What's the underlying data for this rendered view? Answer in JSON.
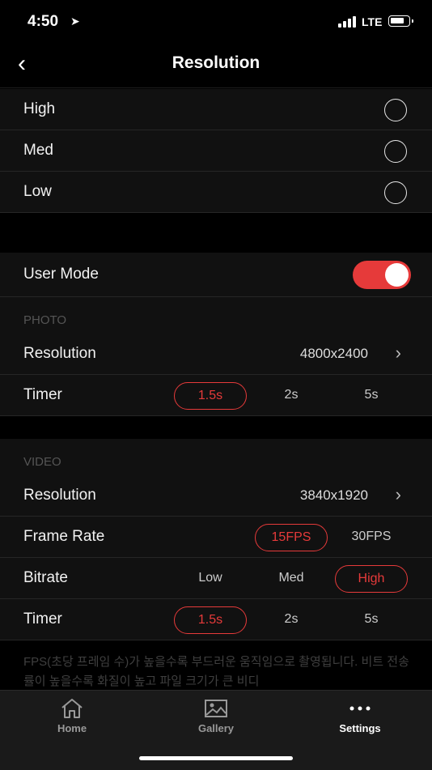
{
  "status_bar": {
    "time": "4:50",
    "network": "LTE"
  },
  "nav": {
    "title": "Resolution"
  },
  "resolution_options": [
    {
      "label": "High"
    },
    {
      "label": "Med"
    },
    {
      "label": "Low"
    }
  ],
  "user_mode": {
    "label": "User Mode",
    "enabled": true
  },
  "photo": {
    "section_label": "PHOTO",
    "resolution_label": "Resolution",
    "resolution_value": "4800x2400",
    "timer_label": "Timer",
    "timer_options": [
      "1.5s",
      "2s",
      "5s"
    ],
    "timer_selected": "1.5s"
  },
  "video": {
    "section_label": "VIDEO",
    "resolution_label": "Resolution",
    "resolution_value": "3840x1920",
    "frame_rate_label": "Frame Rate",
    "frame_rate_options": [
      "15FPS",
      "30FPS"
    ],
    "frame_rate_selected": "15FPS",
    "bitrate_label": "Bitrate",
    "bitrate_options": [
      "Low",
      "Med",
      "High"
    ],
    "bitrate_selected": "High",
    "timer_label": "Timer",
    "timer_options": [
      "1.5s",
      "2s",
      "5s"
    ],
    "timer_selected": "1.5s"
  },
  "note": "FPS(초당 프레임 수)가 높을수록 부드러운 움직임으로 촬영됩니다. 비트 전송률이 높을수록 화질이 높고 파일 크기가 큰 비디",
  "tabbar": {
    "home": "Home",
    "gallery": "Gallery",
    "settings": "Settings"
  },
  "colors": {
    "accent": "#e63a3a",
    "background": "#000000",
    "row": "#111111"
  },
  "icons": {
    "back": "chevron-left-icon",
    "chevron": "chevron-right-icon",
    "home": "home-icon",
    "gallery": "image-icon",
    "settings": "more-dots-icon"
  }
}
